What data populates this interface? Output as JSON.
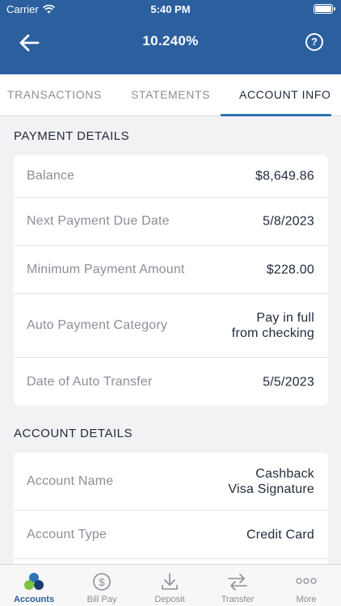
{
  "status_bar": {
    "carrier": "Carrier",
    "time": "5:40 PM"
  },
  "header": {
    "title": "10.240%",
    "back_icon": "arrow-left-icon",
    "help_icon": "question-circle-icon",
    "help_glyph": "?"
  },
  "tabs": [
    {
      "label": "TRANSACTIONS",
      "active": false
    },
    {
      "label": "STATEMENTS",
      "active": false
    },
    {
      "label": "ACCOUNT INFO",
      "active": true
    }
  ],
  "payment_details": {
    "title": "PAYMENT DETAILS",
    "rows": [
      {
        "label": "Balance",
        "value": [
          "$8,649.86"
        ]
      },
      {
        "label": "Next Payment Due Date",
        "value": [
          "5/8/2023"
        ]
      },
      {
        "label": "Minimum Payment Amount",
        "value": [
          "$228.00"
        ]
      },
      {
        "label": "Auto Payment Category",
        "value": [
          "Pay in full",
          "from checking"
        ]
      },
      {
        "label": "Date of Auto Transfer",
        "value": [
          "5/5/2023"
        ]
      }
    ]
  },
  "account_details": {
    "title": "ACCOUNT DETAILS",
    "rows": [
      {
        "label": "Account Name",
        "value": [
          "Cashback",
          "Visa Signature"
        ]
      },
      {
        "label": "Account Type",
        "value": [
          "Credit Card"
        ]
      }
    ]
  },
  "tab_bar": [
    {
      "label": "Accounts",
      "icon": "accounts-circles-icon",
      "active": true
    },
    {
      "label": "Bill Pay",
      "icon": "dollar-circle-icon",
      "active": false
    },
    {
      "label": "Deposit",
      "icon": "download-tray-icon",
      "active": false
    },
    {
      "label": "Transfer",
      "icon": "transfer-arrows-icon",
      "active": false
    },
    {
      "label": "More",
      "icon": "more-dots-icon",
      "active": false
    }
  ],
  "colors": {
    "brand": "#2b5f9e",
    "accent": "#2f74b8",
    "accounts_icon_blue": "#2f74b8",
    "accounts_icon_green": "#7dc242",
    "accounts_icon_navy": "#1b3d6e"
  }
}
